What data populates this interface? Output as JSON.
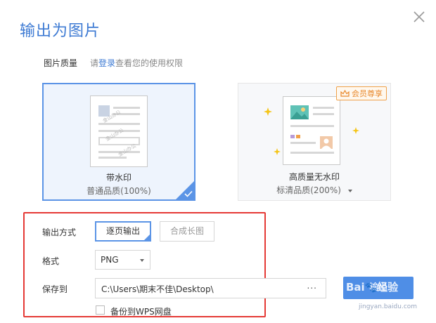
{
  "dialog": {
    "title": "输出为图片"
  },
  "quality": {
    "label": "图片质量",
    "hint_prefix": "请",
    "hint_link": "登录",
    "hint_suffix": "查看您的使用权限",
    "options": [
      {
        "name": "带水印",
        "sub": "普通品质(100%)",
        "selected": true,
        "watermark_text": "金山办公"
      },
      {
        "name": "高质量无水印",
        "sub": "标清品质(200%)",
        "selected": false,
        "badge": "会员尊享"
      }
    ]
  },
  "output": {
    "mode_label": "输出方式",
    "modes": [
      "逐页输出",
      "合成长图"
    ],
    "selected_mode": 0,
    "format_label": "格式",
    "format_value": "PNG",
    "save_label": "保存到",
    "save_path": "C:\\Users\\期末不佳\\Desktop\\",
    "browse": "...",
    "backup_label": "备份到WPS网盘",
    "backup_checked": false
  },
  "actions": {
    "export_label": "输出"
  },
  "watermark": {
    "brand": "Bai",
    "brand2": "经验",
    "url": "jingyan.baidu.com"
  },
  "colors": {
    "accent": "#4f8ee6",
    "highlight": "#e53935",
    "gold": "#e8882b"
  }
}
